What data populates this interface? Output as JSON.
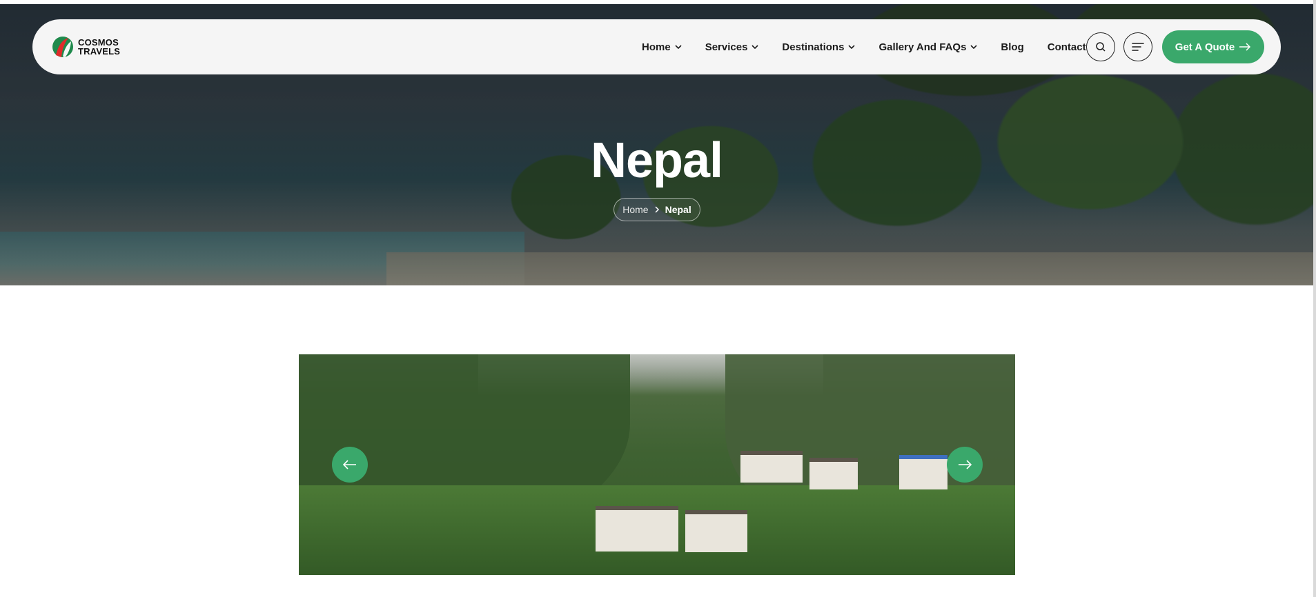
{
  "brand": {
    "name_line1": "COSMOS",
    "name_line2": "TRAVELS",
    "colors": {
      "red": "#e02b2b",
      "green": "#1f8a4c"
    }
  },
  "nav": {
    "items": [
      {
        "label": "Home",
        "has_dropdown": true
      },
      {
        "label": "Services",
        "has_dropdown": true
      },
      {
        "label": "Destinations",
        "has_dropdown": true
      },
      {
        "label": "Gallery And FAQs",
        "has_dropdown": true
      },
      {
        "label": "Blog",
        "has_dropdown": false
      },
      {
        "label": "Contact",
        "has_dropdown": false
      }
    ],
    "search_icon": "search-icon",
    "menu_icon": "menu-icon",
    "cta_label": "Get A Quote",
    "cta_icon": "arrow-right-icon"
  },
  "hero": {
    "title": "Nepal",
    "breadcrumb": {
      "home": "Home",
      "current": "Nepal"
    }
  },
  "gallery": {
    "prev_icon": "arrow-left-icon",
    "next_icon": "arrow-right-icon",
    "image_alt": "Mountain village in Nepal"
  },
  "colors": {
    "accent": "#3aa86b",
    "navbar_bg": "#f5f5f5",
    "text_dark": "#1b1b1b"
  }
}
